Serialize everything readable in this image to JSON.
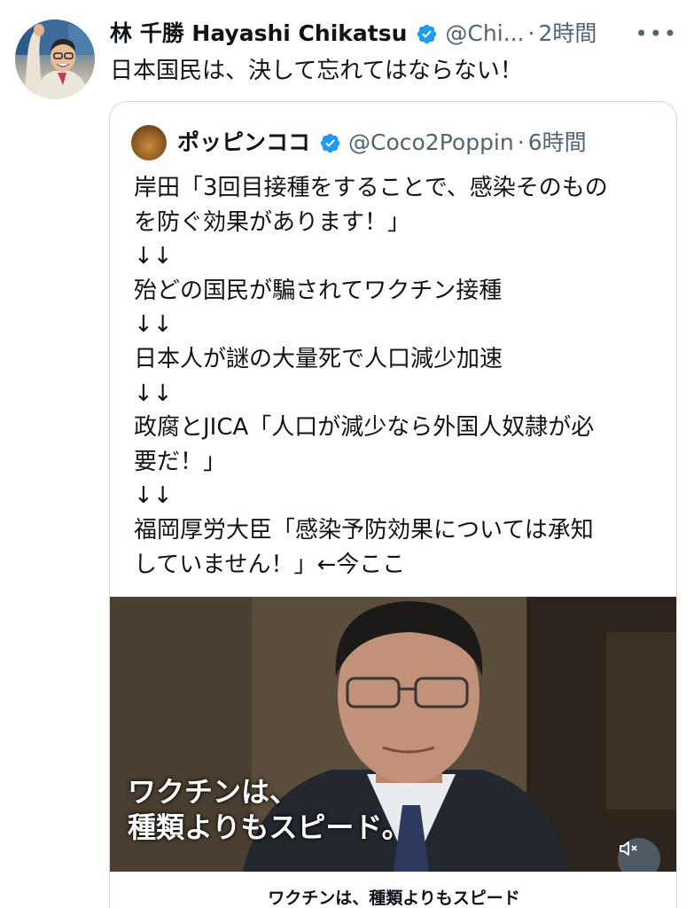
{
  "tweet": {
    "author_name": "林 千勝 Hayashi Chikatsu",
    "handle": "@Chi...",
    "separator": "·",
    "time": "2時間",
    "more_label": "•••",
    "text": "日本国民は、決して忘れてはならない！"
  },
  "quote": {
    "author_name": "ポッピンココ",
    "handle": "@Coco2Poppin",
    "separator": "·",
    "time": "6時間",
    "lines": [
      "岸田「3回目接種をすることで、感染そのもの",
      "を防ぐ効果があります！」",
      "↓↓",
      "殆どの国民が騙されてワクチン接種",
      "↓↓",
      "日本人が謎の大量死で人口減少加速",
      "↓↓",
      "政腐とJICA「人口が減少なら外国人奴隷が必",
      "要だ！」",
      "↓↓",
      "福岡厚労大臣「感染予防効果については承知",
      "していません！」←今ここ"
    ],
    "media": {
      "caption_line1": "ワクチンは、",
      "caption_line2": "種類よりもスピード。",
      "title": "ワクチンは、種類よりもスピード",
      "mute_icon": "speaker-muted-icon"
    }
  },
  "colors": {
    "verified": "#1d9bf0",
    "secondary_text": "#536471",
    "border": "#cfd9de"
  }
}
